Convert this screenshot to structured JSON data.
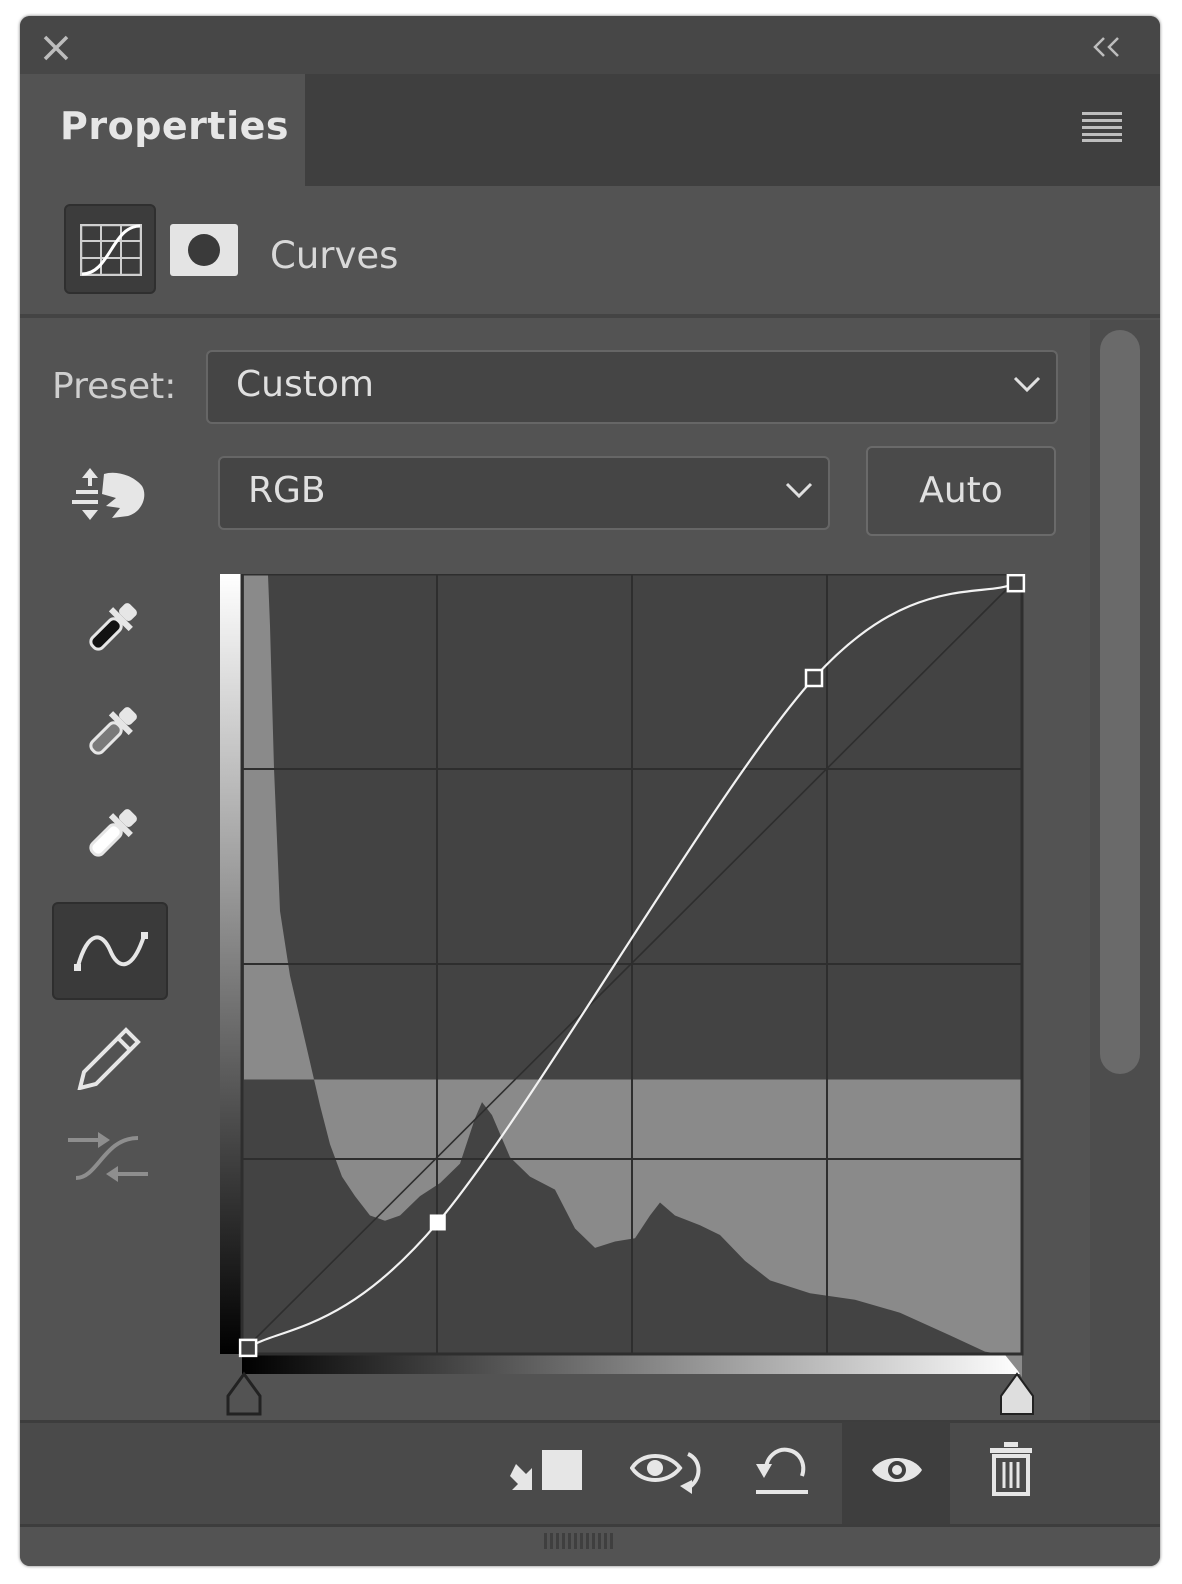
{
  "window": {
    "close_icon": "close-icon",
    "collapse_icon": "double-chevron-left-icon"
  },
  "tab": {
    "label": "Properties",
    "menu_icon": "panel-menu-icon"
  },
  "adjustment": {
    "title": "Curves",
    "icons": [
      "curves-adjustment-icon",
      "layer-mask-icon"
    ]
  },
  "preset": {
    "label": "Preset:",
    "value": "Custom"
  },
  "channel": {
    "value": "RGB"
  },
  "auto_button": {
    "label": "Auto"
  },
  "tools": [
    "targeted-adjustment-icon",
    "black-point-eyedropper-icon",
    "gray-point-eyedropper-icon",
    "white-point-eyedropper-icon",
    "curve-edit-icon",
    "pencil-draw-icon",
    "smooth-curve-icon"
  ],
  "curve": {
    "input_range": [
      0,
      255
    ],
    "output_range": [
      0,
      255
    ],
    "control_points": [
      {
        "input": 2,
        "output": 2
      },
      {
        "input": 64,
        "output": 43
      },
      {
        "input": 187,
        "output": 221
      },
      {
        "input": 253,
        "output": 252
      }
    ]
  },
  "footer_buttons": [
    "clip-to-layer-icon",
    "view-previous-state-icon",
    "reset-adjustments-icon",
    "toggle-visibility-icon",
    "delete-layer-icon"
  ],
  "colors": {
    "panel_bg": "#535353",
    "histogram": "#8a8a8a",
    "curve": "#ffffff"
  }
}
